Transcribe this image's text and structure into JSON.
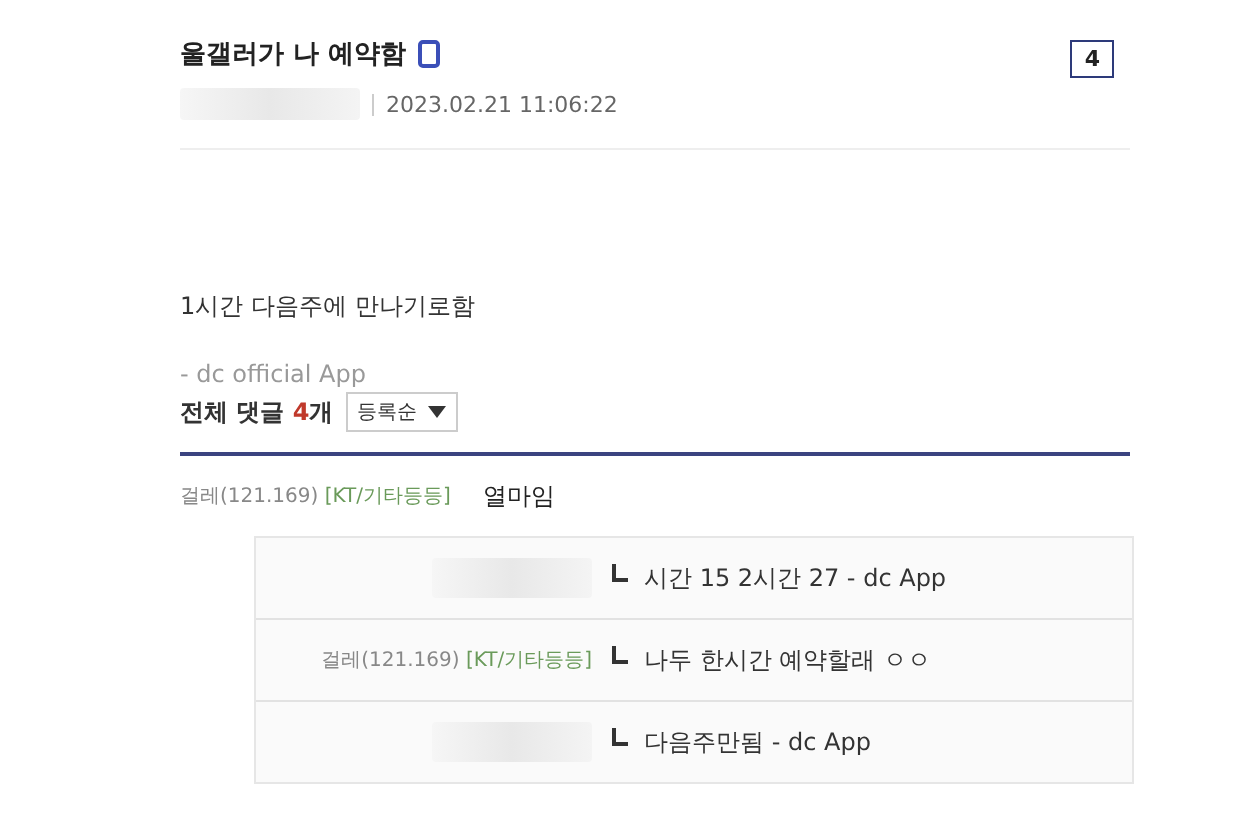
{
  "post": {
    "title": "울갤러가 나 예약함",
    "mobile": true,
    "date": "2023.02.21 11:06:22",
    "count": "4",
    "body": "1시간 다음주에 만나기로함",
    "signature": "- dc official App"
  },
  "comments_header": {
    "label": "전체 댓글",
    "count": "4",
    "unit": "개",
    "sort": "등록순"
  },
  "comments": [
    {
      "author": "걸레(121.169)",
      "tag": "[KT/기타등등]",
      "text": "열마임",
      "replies": [
        {
          "text": "시간 15 2시간 27 - dc App"
        },
        {
          "author": "걸레(121.169)",
          "tag": "[KT/기타등등]",
          "text": "나두 한시간 예약할래 ㅇㅇ"
        },
        {
          "text": "다음주만됨 - dc App"
        }
      ]
    }
  ]
}
